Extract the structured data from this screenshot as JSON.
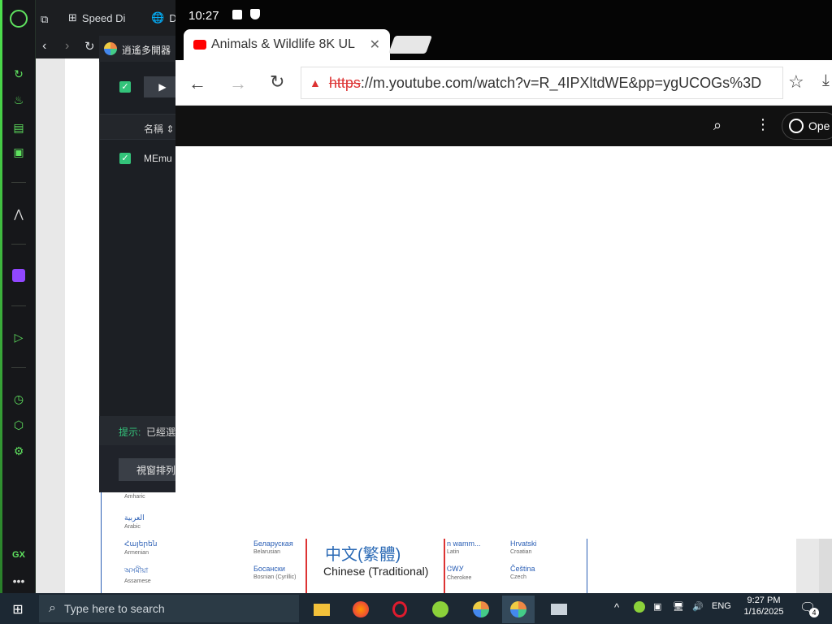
{
  "opera": {
    "tabs": [
      {
        "label": "Speed Di",
        "icon": "grid-icon"
      },
      {
        "label": "D",
        "icon": "globe-icon"
      }
    ],
    "sidebar_label_gx": "GX",
    "sidebar_more": "•••"
  },
  "multi_opener": {
    "title": "逍遙多開器",
    "play_label": "▶",
    "col_name": "名稱 ⇕",
    "row_name": "MEmu",
    "hint_label": "提示:",
    "hint_text": "已經選",
    "foot_button": "視窗排列"
  },
  "android": {
    "time": "10:27",
    "tab_title": "Animals & Wildlife 8K UL",
    "url_scheme": "https",
    "url_rest": "://m.youtube.com/watch?v=R_4IPXltdWE&pp=ygUCOGs%3D",
    "yt_open_label": "Ope"
  },
  "language_panel": {
    "big_lang": "中文(繁體)",
    "big_lang_sub": "Chinese (Traditional)",
    "items": [
      {
        "native": "العربية",
        "en": "Arabic"
      },
      {
        "native": "Հայերեն",
        "en": "Armenian"
      },
      {
        "native": "অসমীয়া",
        "en": "Assamese"
      },
      {
        "native": "Беларуская",
        "en": "Belarusian"
      },
      {
        "native": "Босански",
        "en": "Bosnian (Cyrillic)"
      },
      {
        "native": "n wamm...",
        "en": "Latin"
      },
      {
        "native": "ᏣᎳᎩ",
        "en": "Cherokee"
      },
      {
        "native": "Hrvatski",
        "en": "Croatian"
      },
      {
        "native": "Čeština",
        "en": "Czech"
      },
      {
        "native": "",
        "en": "Amharic"
      }
    ]
  },
  "taskbar": {
    "search_placeholder": "Type here to search",
    "time": "9:27 PM",
    "date": "1/16/2025",
    "lang": "ENG",
    "notif_count": "4"
  }
}
